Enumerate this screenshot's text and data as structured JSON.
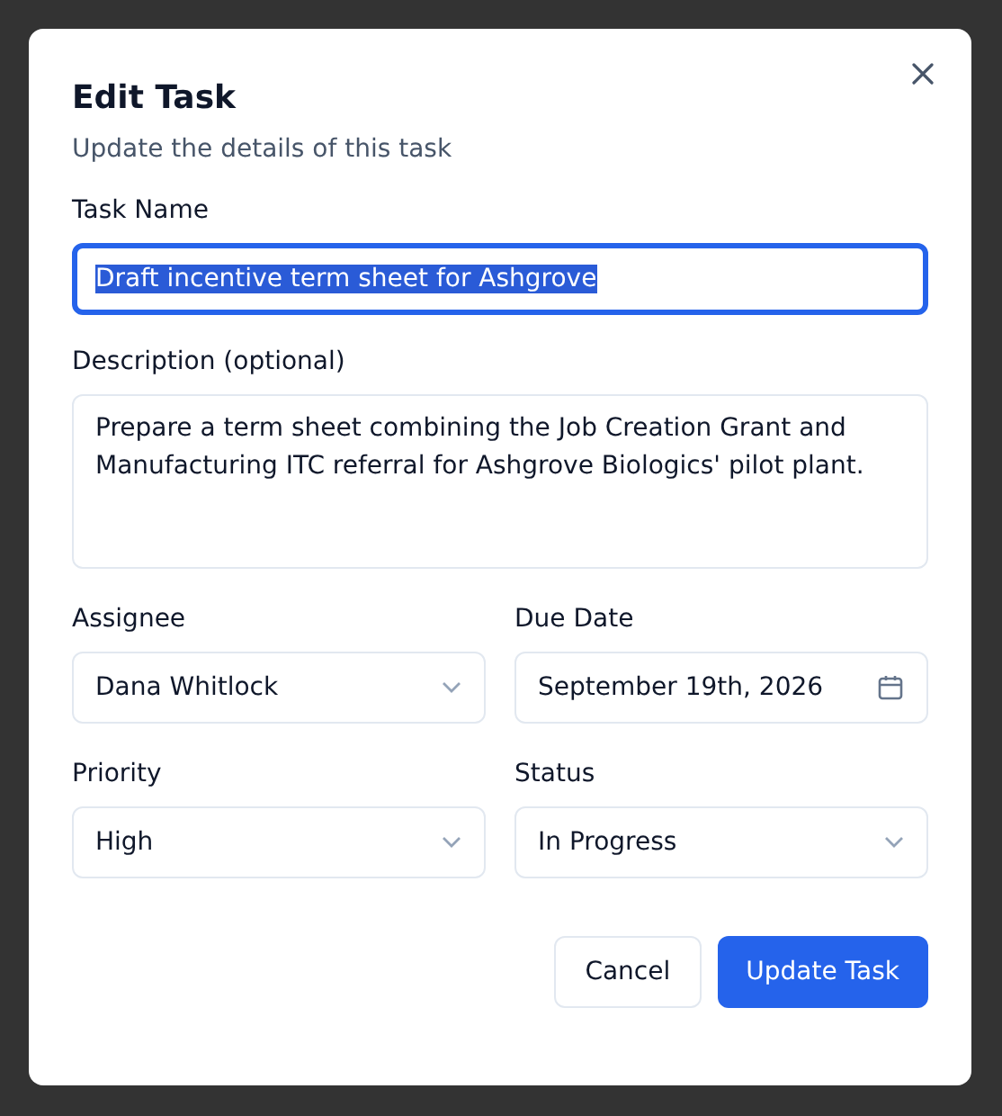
{
  "dialog": {
    "title": "Edit Task",
    "subtitle": "Update the details of this task",
    "task_name": {
      "label": "Task Name",
      "value": "Draft incentive term sheet for Ashgrove",
      "focused": true,
      "text_selected": true
    },
    "description": {
      "label": "Description (optional)",
      "value": "Prepare a term sheet combining the Job Creation Grant and Manufacturing ITC referral for Ashgrove Biologics' pilot plant."
    },
    "fields": [
      {
        "label": "Assignee",
        "value": "Dana Whitlock",
        "kind": "select"
      },
      {
        "label": "Due Date",
        "value": "September 19th, 2026",
        "kind": "date"
      },
      {
        "label": "Priority",
        "value": "High",
        "kind": "select"
      },
      {
        "label": "Status",
        "value": "In Progress",
        "kind": "select"
      }
    ],
    "buttons": [
      {
        "label": "Cancel",
        "kind": "secondary"
      },
      {
        "label": "Update Task",
        "kind": "primary"
      }
    ]
  }
}
